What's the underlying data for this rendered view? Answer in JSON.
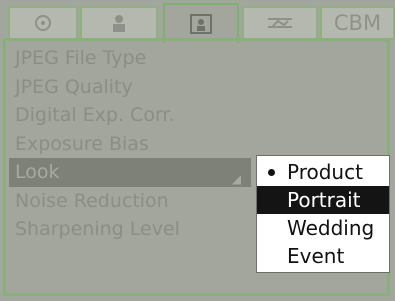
{
  "tabs": [
    {
      "icon": "camera-icon",
      "label": ""
    },
    {
      "icon": "person-icon",
      "label": ""
    },
    {
      "icon": "portrait-frame-icon",
      "label": "",
      "active": true
    },
    {
      "icon": "landscape-icon",
      "label": ""
    },
    {
      "icon": "",
      "label": "CBM"
    }
  ],
  "menu": {
    "items": [
      {
        "label": "JPEG File Type"
      },
      {
        "label": "JPEG Quality"
      },
      {
        "label": "Digital Exp. Corr."
      },
      {
        "label": "Exposure Bias"
      },
      {
        "label": "Look",
        "selected": true,
        "has_submenu": true
      },
      {
        "label": "Noise Reduction"
      },
      {
        "label": "Sharpening Level"
      }
    ]
  },
  "popup": {
    "options": [
      {
        "label": "Product",
        "checked": true
      },
      {
        "label": "Portrait",
        "highlighted": true
      },
      {
        "label": "Wedding"
      },
      {
        "label": "Event"
      }
    ]
  },
  "colors": {
    "highlight_bg": "#141414",
    "popup_bg": "#ffffff",
    "tab_border": "#8fb07f"
  }
}
